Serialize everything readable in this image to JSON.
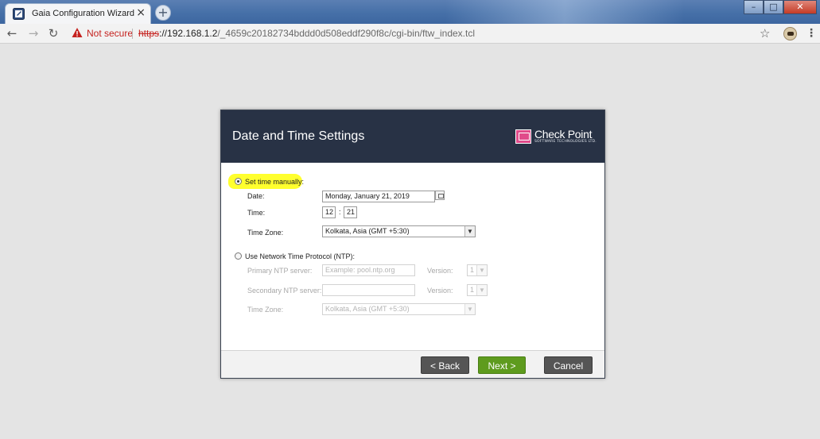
{
  "browser": {
    "tab_title": "Gaia Configuration Wizard",
    "tab_close": "×",
    "new_tab": "+",
    "not_secure": "Not secure",
    "url_scheme": "https",
    "url_host": "://192.168.1.2",
    "url_path": "/_4659c20182734bddd0d508eddf290f8c/cgi-bin/ftw_index.tcl",
    "window_controls": {
      "minimize": "–",
      "maximize": "□",
      "close": "✕"
    },
    "icons": [
      "back-arrow-icon",
      "forward-arrow-icon",
      "reload-icon",
      "warning-icon",
      "star-icon",
      "profile-avatar-icon",
      "kebab-menu-icon"
    ]
  },
  "dialog": {
    "title": "Date and Time Settings",
    "logo": {
      "name": "Check Point",
      "subtitle": "SOFTWARE TECHNOLOGIES LTD."
    },
    "manual": {
      "label": "Set time manually:",
      "selected": true,
      "date_label": "Date:",
      "date_value": "Monday, January 21, 2019",
      "time_label": "Time:",
      "hour": "12",
      "colon": ":",
      "minute": "21",
      "timezone_label": "Time Zone:",
      "timezone_value": "Kolkata, Asia (GMT +5:30)"
    },
    "ntp": {
      "label": "Use Network Time Protocol (NTP):",
      "selected": false,
      "primary_label": "Primary NTP server:",
      "primary_placeholder": "Example: pool.ntp.org",
      "secondary_label": "Secondary NTP server:",
      "secondary_value": "",
      "version_label": "Version:",
      "primary_version": "1",
      "secondary_version": "1",
      "timezone_label": "Time Zone:",
      "timezone_value": "Kolkata, Asia (GMT +5:30)"
    },
    "buttons": {
      "back": "< Back",
      "next": "Next >",
      "cancel": "Cancel"
    }
  },
  "colors": {
    "header_bg": "#283245",
    "next_button": "#5e9b1e",
    "gray_button": "#555555",
    "highlight": "#ffff2e",
    "not_secure_red": "#c5221f"
  }
}
